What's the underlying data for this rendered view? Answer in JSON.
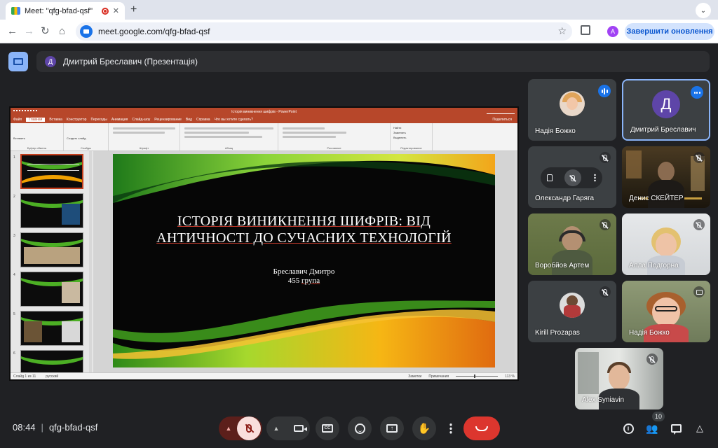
{
  "browser": {
    "tab_title": "Meet: \"qfg-bfad-qsf\"",
    "url": "meet.google.com/qfg-bfad-qsf",
    "profile_initial": "A",
    "update_button": "Завершити оновлення"
  },
  "meeting": {
    "presenter_label": "Дмитрий Бреславич (Презентація)",
    "presenter_initial": "Д",
    "time": "08:44",
    "code": "qfg-bfad-qsf",
    "participant_count": "10"
  },
  "ppt": {
    "window_title": "Історія виникнення шифрів - PowerPoint",
    "tabs": [
      "Файл",
      "Главная",
      "Вставка",
      "Конструктор",
      "Переходы",
      "Анимация",
      "Слайд-шоу",
      "Рецензирование",
      "Вид",
      "Справка",
      "Что вы хотите сделать?"
    ],
    "active_tab": "Главная",
    "share_label": "Поделиться",
    "ribbon_groups": [
      "Буфер обмена",
      "Слайды",
      "Шрифт",
      "Абзац",
      "Рисование",
      "Редактирование"
    ],
    "ribbon_items": {
      "paste": "Вставить",
      "new_slide": "Создать слайд",
      "find": "Найти",
      "replace": "Заменить",
      "select": "Выделить"
    },
    "thumbnail_numbers": [
      "1",
      "2",
      "3",
      "4",
      "5",
      "6"
    ],
    "status_slide": "Слайд 1 из 11",
    "status_lang": "русский",
    "status_notes": "Заметки",
    "status_comments": "Примечания",
    "status_zoom": "113 %"
  },
  "slide": {
    "title": "ІСТОРІЯ ВИНИКНЕННЯ ШИФРІВ: ВІД АНТИЧНОСТІ ДО СУЧАСНИХ ТЕХНОЛОГІЙ",
    "author": "Бреславич Дмитро",
    "group_number": "455",
    "group_word": "група"
  },
  "participants": [
    {
      "name": "Надія Божко",
      "state": "speaking"
    },
    {
      "name": "Дмитрий Бреславич",
      "initial": "Д",
      "state": "speaking"
    },
    {
      "name": "Олександр Гаряга",
      "state": "muted"
    },
    {
      "name": "Денис СКЕЙТЕР",
      "state": "muted"
    },
    {
      "name": "Воробйов Артем",
      "state": "muted"
    },
    {
      "name": "Алла Подгорна",
      "state": "muted"
    },
    {
      "name": "Kirill Prozapas",
      "state": "muted"
    },
    {
      "name": "Надія Божко",
      "state": "presenting"
    },
    {
      "name": "Alex Syniavin",
      "state": "muted"
    }
  ],
  "colors": {
    "meet_bg": "#202124",
    "tile_bg": "#3c4043",
    "accent": "#8ab4f8",
    "hangup": "#dc362e",
    "ppt_brand": "#b7472a",
    "mic_muted_bg": "#f9dedc"
  },
  "icons": {
    "mic": "mic-off-icon",
    "camera": "camera-icon",
    "captions": "captions-icon",
    "reactions": "emoji-icon",
    "present": "present-screen-icon",
    "hand": "raise-hand-icon",
    "more": "more-vert-icon",
    "hangup": "call-end-icon",
    "info": "info-icon",
    "people": "people-icon",
    "chat": "chat-icon",
    "activities": "activities-icon"
  }
}
